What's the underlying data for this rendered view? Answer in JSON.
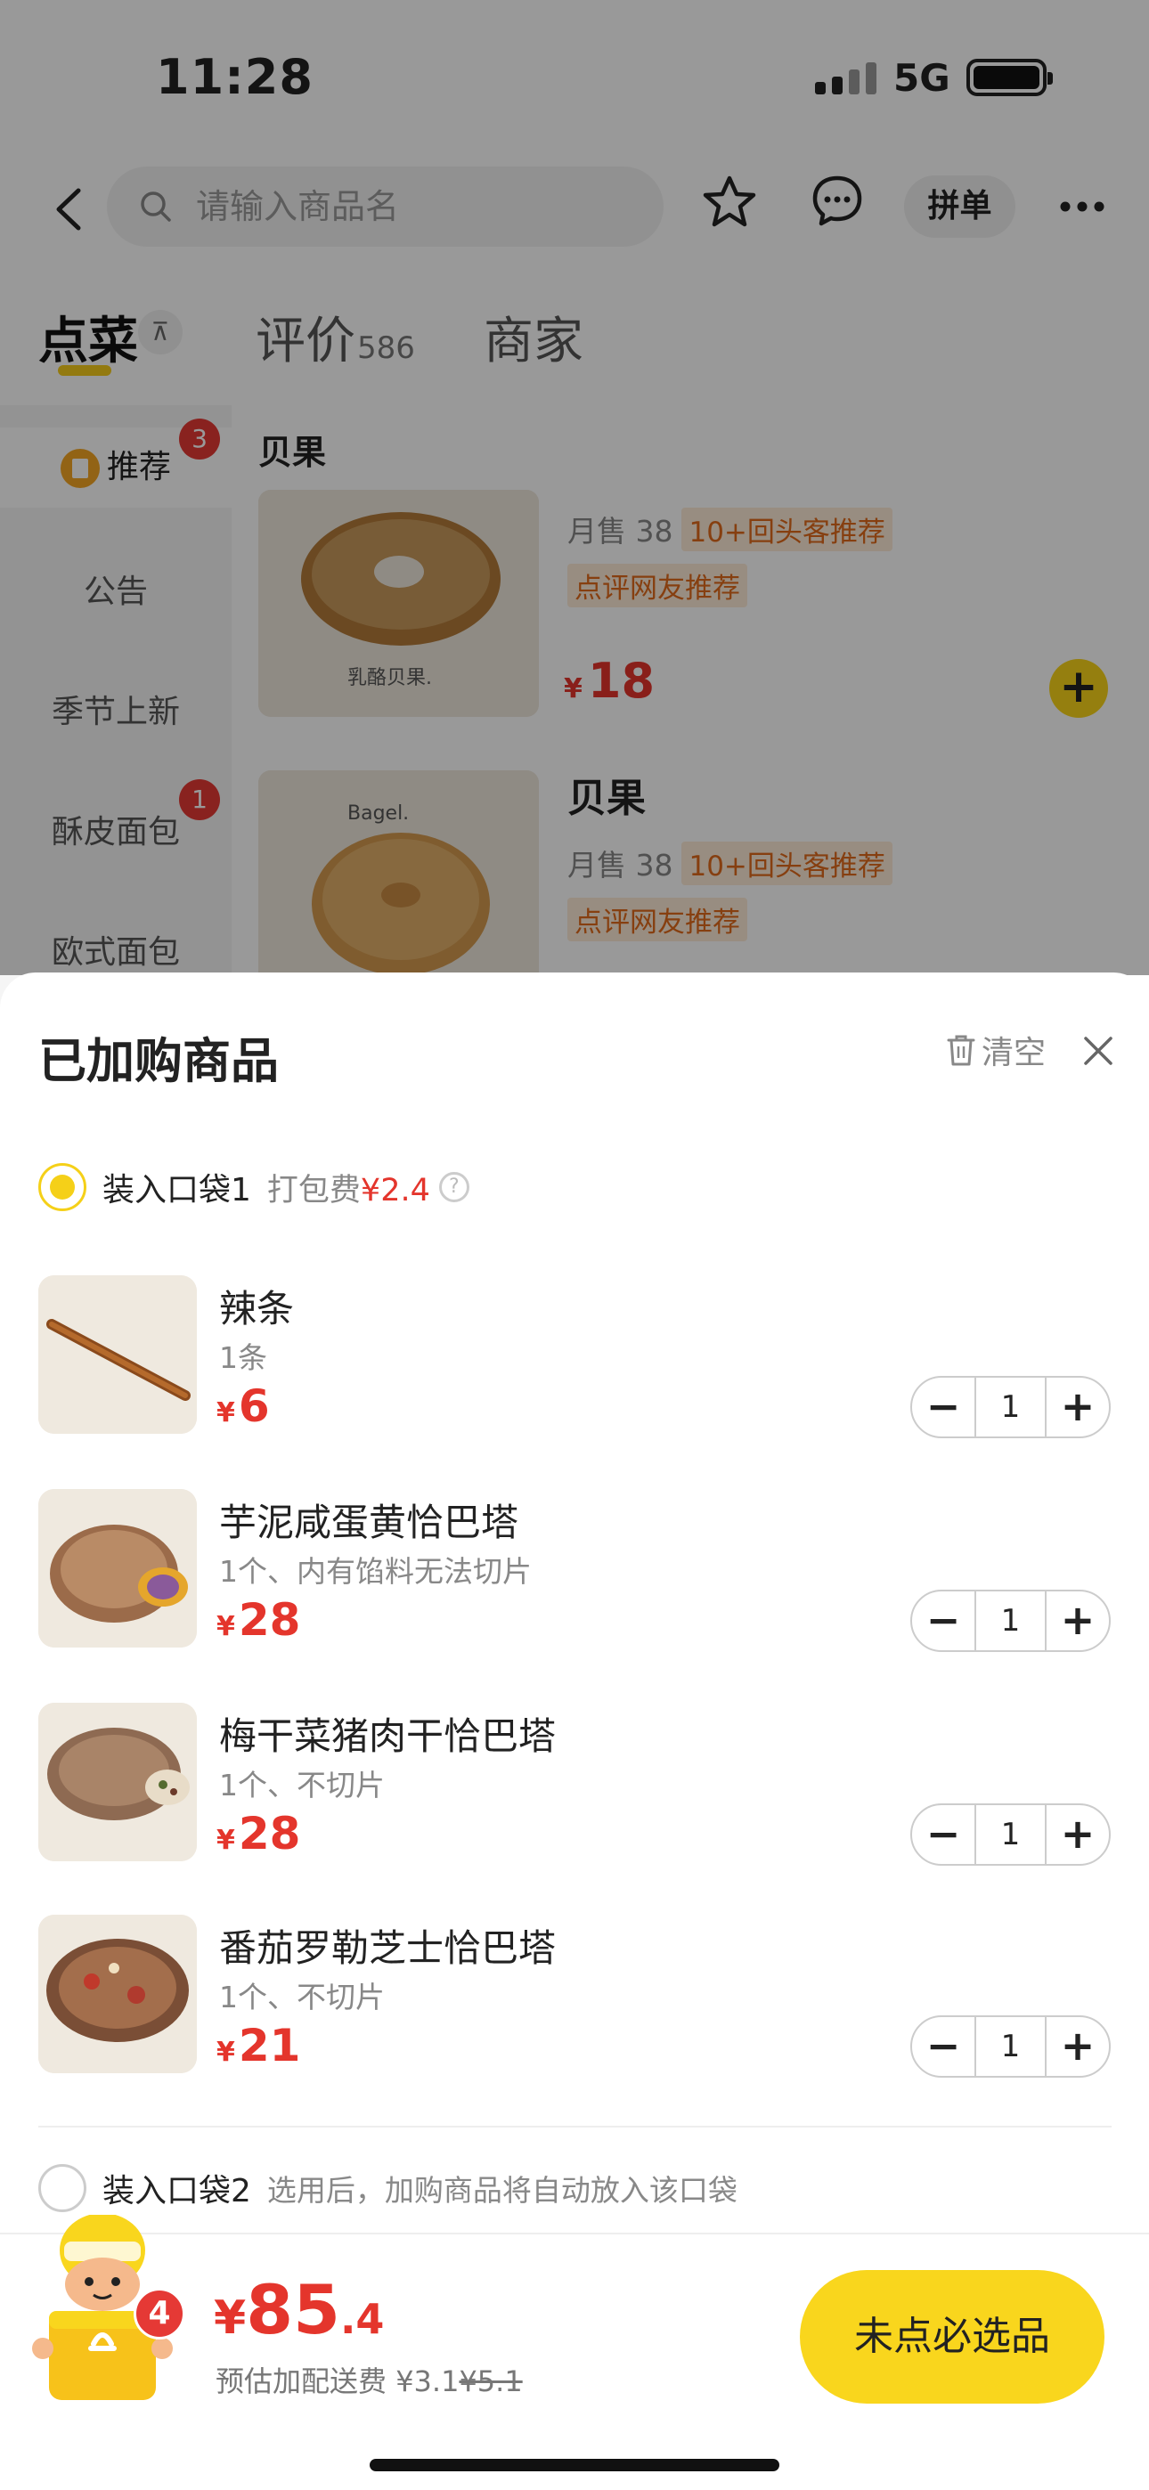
{
  "status_bar": {
    "time": "11:28",
    "network": "5G"
  },
  "nav": {
    "search_placeholder": "请输入商品名",
    "group_order": "拼单"
  },
  "tabs": [
    {
      "label": "点菜",
      "count": ""
    },
    {
      "label": "评价",
      "count": "586"
    },
    {
      "label": "商家",
      "count": ""
    }
  ],
  "sidebar": {
    "items": [
      {
        "label": "推荐",
        "badge": "3"
      },
      {
        "label": "公告",
        "badge": ""
      },
      {
        "label": "季节上新",
        "badge": ""
      },
      {
        "label": "酥皮面包",
        "badge": "1"
      },
      {
        "label": "欧式面包",
        "badge": ""
      }
    ]
  },
  "menu": {
    "category": "贝果",
    "products": [
      {
        "name": "",
        "sales": "月售 38",
        "tag1": "10+回头客推荐",
        "tag2": "点评网友推荐",
        "currency": "¥",
        "price": "18",
        "img_caption": "乳酪贝果."
      },
      {
        "name": "贝果",
        "sales": "月售 38",
        "tag1": "10+回头客推荐",
        "tag2": "点评网友推荐",
        "currency": "¥",
        "price": "",
        "img_caption": "Bagel."
      }
    ]
  },
  "cart": {
    "title": "已加购商品",
    "clear_label": "清空",
    "bag1": {
      "label": "装入口袋1",
      "pack_fee_label": "打包费",
      "pack_fee": "¥2.4"
    },
    "items": [
      {
        "name": "辣条",
        "spec": "1条",
        "currency": "¥",
        "price": "6",
        "qty": "1"
      },
      {
        "name": "芋泥咸蛋黄恰巴塔",
        "spec": "1个、内有馅料无法切片",
        "currency": "¥",
        "price": "28",
        "qty": "1"
      },
      {
        "name": "梅干菜猪肉干恰巴塔",
        "spec": "1个、不切片",
        "currency": "¥",
        "price": "28",
        "qty": "1"
      },
      {
        "name": "番茄罗勒芝士恰巴塔",
        "spec": "1个、不切片",
        "currency": "¥",
        "price": "21",
        "qty": "1"
      }
    ],
    "bag2": {
      "label": "装入口袋2",
      "hint": "选用后，加购商品将自动放入该口袋"
    }
  },
  "checkout": {
    "count": "4",
    "currency": "¥",
    "total_int": "85",
    "total_dec": ".4",
    "delivery_label": "预估加配送费",
    "delivery_fee": "¥3.1",
    "delivery_original": "¥5.1",
    "submit_label": "未点必选品"
  },
  "colors": {
    "accent": "#f9d61d",
    "price": "#e4352c",
    "badge": "#e53935"
  }
}
